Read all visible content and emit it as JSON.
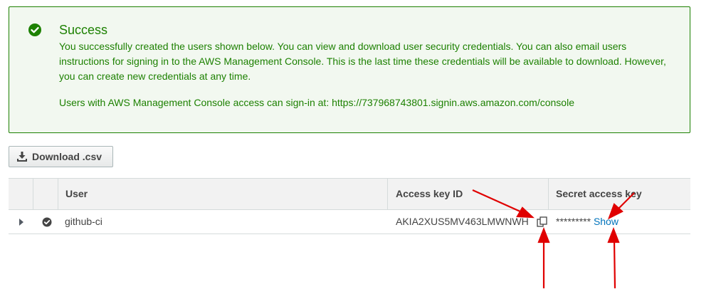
{
  "alert": {
    "icon": "check-circle-icon",
    "title": "Success",
    "message": "You successfully created the users shown below. You can view and download user security credentials. You can also email users instructions for signing in to the AWS Management Console. This is the last time these credentials will be available to download. However, you can create new credentials at any time.",
    "console_prefix": "Users with AWS Management Console access can sign-in at: ",
    "console_url": "https://737968743801.signin.aws.amazon.com/console",
    "accent_color": "#1d8102",
    "background_color": "#f2f8f0"
  },
  "toolbar": {
    "download_label": "Download .csv",
    "download_icon": "download-icon"
  },
  "table": {
    "columns": [
      "User",
      "Access key ID",
      "Secret access key"
    ],
    "rows": [
      {
        "user": "github-ci",
        "access_key_id": "AKIA2XUS5MV463LMWNWH",
        "secret_masked": "*********",
        "show_label": "Show"
      }
    ]
  },
  "annotations": {
    "arrow_color": "#e00000"
  },
  "colors": {
    "link": "#0073bb",
    "border": "#d5dbdb",
    "header_bg": "#f2f2f2"
  }
}
